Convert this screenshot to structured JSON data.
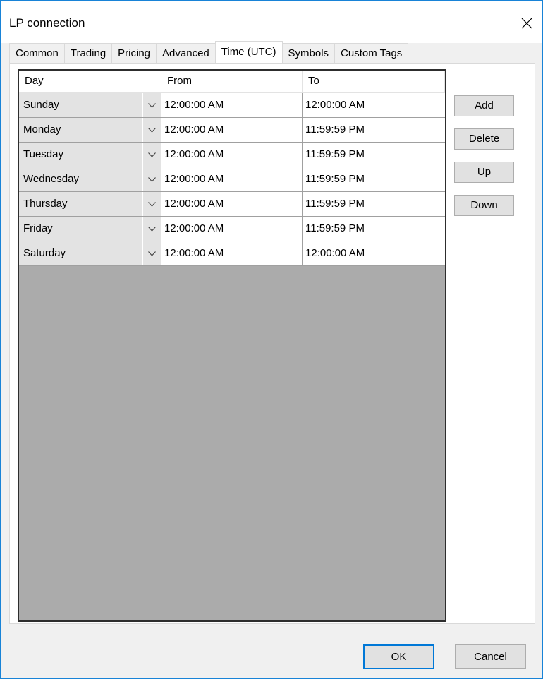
{
  "window": {
    "title": "LP connection"
  },
  "tabs": [
    {
      "label": "Common"
    },
    {
      "label": "Trading"
    },
    {
      "label": "Pricing"
    },
    {
      "label": "Advanced"
    },
    {
      "label": "Time (UTC)",
      "active": true
    },
    {
      "label": "Symbols"
    },
    {
      "label": "Custom Tags"
    }
  ],
  "grid": {
    "columns": [
      "Day",
      "From",
      "To"
    ],
    "rows": [
      {
        "day": "Sunday",
        "from": "12:00:00 AM",
        "to": "12:00:00 AM"
      },
      {
        "day": "Monday",
        "from": "12:00:00 AM",
        "to": "11:59:59 PM"
      },
      {
        "day": "Tuesday",
        "from": "12:00:00 AM",
        "to": "11:59:59 PM"
      },
      {
        "day": "Wednesday",
        "from": "12:00:00 AM",
        "to": "11:59:59 PM"
      },
      {
        "day": "Thursday",
        "from": "12:00:00 AM",
        "to": "11:59:59 PM"
      },
      {
        "day": "Friday",
        "from": "12:00:00 AM",
        "to": "11:59:59 PM"
      },
      {
        "day": "Saturday",
        "from": "12:00:00 AM",
        "to": "12:00:00 AM"
      }
    ]
  },
  "side_buttons": {
    "add": "Add",
    "delete": "Delete",
    "up": "Up",
    "down": "Down"
  },
  "footer": {
    "ok": "OK",
    "cancel": "Cancel"
  },
  "colors": {
    "grid_background": "#ababab",
    "accent": "#0078d7"
  }
}
